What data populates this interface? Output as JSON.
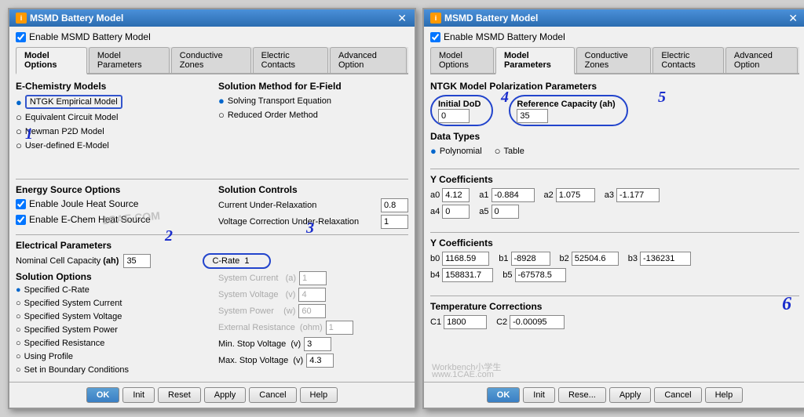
{
  "left_dialog": {
    "title": "MSMD Battery Model",
    "enable_label": "Enable MSMD Battery Model",
    "tabs": [
      {
        "label": "Model Options",
        "active": true
      },
      {
        "label": "Model Parameters",
        "active": false
      },
      {
        "label": "Conductive Zones",
        "active": false
      },
      {
        "label": "Electric Contacts",
        "active": false
      },
      {
        "label": "Advanced Option",
        "active": false
      }
    ],
    "echem_section": "E-Chemistry Models",
    "echem_models": [
      {
        "label": "NTGK Empirical Model",
        "selected": true,
        "highlighted": true
      },
      {
        "label": "Equivalent Circuit Model",
        "selected": false
      },
      {
        "label": "Newman P2D Model",
        "selected": false
      },
      {
        "label": "User-defined E-Model",
        "selected": false
      }
    ],
    "solution_method_section": "Solution Method for E-Field",
    "solution_methods": [
      {
        "label": "Solving Transport Equation",
        "selected": true
      },
      {
        "label": "Reduced Order Method",
        "selected": false
      }
    ],
    "energy_section": "Energy Source Options",
    "energy_opts": [
      {
        "label": "Enable Joule Heat Source",
        "checked": true
      },
      {
        "label": "Enable E-Chem Heat Source",
        "checked": true
      }
    ],
    "solution_controls_section": "Solution Controls",
    "solution_controls": [
      {
        "label": "Current Under-Relaxation",
        "value": "0.8"
      },
      {
        "label": "Voltage Correction Under-Relaxation",
        "value": "1"
      }
    ],
    "electrical_section": "Electrical Parameters",
    "nominal_label": "Nominal Cell Capacity",
    "nominal_unit": "(ah)",
    "nominal_value": "35",
    "c_rate_label": "C-Rate",
    "c_rate_value": "1",
    "solution_options_section": "Solution Options",
    "solution_opts": [
      {
        "label": "Specified C-Rate",
        "selected": true
      },
      {
        "label": "Specified System Current",
        "selected": false
      },
      {
        "label": "Specified System Voltage",
        "selected": false
      },
      {
        "label": "Specified System Power",
        "selected": false
      },
      {
        "label": "Specified Resistance",
        "selected": false
      },
      {
        "label": "Using Profile",
        "selected": false
      },
      {
        "label": "Set in Boundary Conditions",
        "selected": false
      }
    ],
    "system_current_label": "System Current",
    "system_current_unit": "(a)",
    "system_current_value": "1",
    "system_voltage_label": "System Voltage",
    "system_voltage_unit": "(v)",
    "system_voltage_value": "4",
    "system_power_label": "System Power",
    "system_power_unit": "(w)",
    "system_power_value": "60",
    "ext_resistance_label": "External Resistance",
    "ext_resistance_unit": "(ohm)",
    "ext_resistance_value": "1",
    "min_stop_label": "Min. Stop Voltage",
    "min_stop_unit": "(v)",
    "min_stop_value": "3",
    "max_stop_label": "Max. Stop Voltage",
    "max_stop_unit": "(v)",
    "max_stop_value": "4.3",
    "buttons": [
      "OK",
      "Init",
      "Reset",
      "Apply",
      "Cancel",
      "Help"
    ]
  },
  "right_dialog": {
    "title": "MSMD Battery Model",
    "enable_label": "Enable MSMD Battery Model",
    "tabs": [
      {
        "label": "Model Options",
        "active": false
      },
      {
        "label": "Model Parameters",
        "active": true
      },
      {
        "label": "Conductive Zones",
        "active": false
      },
      {
        "label": "Electric Contacts",
        "active": false
      },
      {
        "label": "Advanced Option",
        "active": false
      }
    ],
    "ntgk_section": "NTGK Model Polarization Parameters",
    "initial_dod_label": "Initial DoD",
    "initial_dod_value": "0",
    "ref_capacity_label": "Reference Capacity (ah)",
    "ref_capacity_value": "35",
    "data_types_section": "Data Types",
    "data_types": [
      {
        "label": "Polynomial",
        "selected": true
      },
      {
        "label": "Table",
        "selected": false
      }
    ],
    "y_coefficients_section": "Y Coefficients",
    "y_coefficients": [
      {
        "name": "a0",
        "value": "4.12"
      },
      {
        "name": "a1",
        "value": "-0.884"
      },
      {
        "name": "a2",
        "value": "1.075"
      },
      {
        "name": "a3",
        "value": "-1.177"
      },
      {
        "name": "a4",
        "value": "0"
      },
      {
        "name": "a5",
        "value": "0"
      }
    ],
    "b_coefficients_section": "Y Coefficients",
    "b_coefficients": [
      {
        "name": "b0",
        "value": "1168.59"
      },
      {
        "name": "b1",
        "value": "-8928"
      },
      {
        "name": "b2",
        "value": "52504.6"
      },
      {
        "name": "b3",
        "value": "-136231"
      },
      {
        "name": "b4",
        "value": "158831.7"
      },
      {
        "name": "b5",
        "value": "-67578.5"
      }
    ],
    "temp_corrections_section": "Temperature Corrections",
    "temp_corrections": [
      {
        "name": "C1",
        "value": "1800"
      },
      {
        "name": "C2",
        "value": "-0.00095"
      }
    ],
    "buttons": [
      "OK",
      "Init",
      "Rese...",
      "Apply",
      "Cancel",
      "Help"
    ]
  },
  "icons": {
    "window_icon": "i",
    "checkbox_checked": "✓",
    "radio_filled": "●",
    "radio_empty": "○",
    "close": "✕"
  }
}
